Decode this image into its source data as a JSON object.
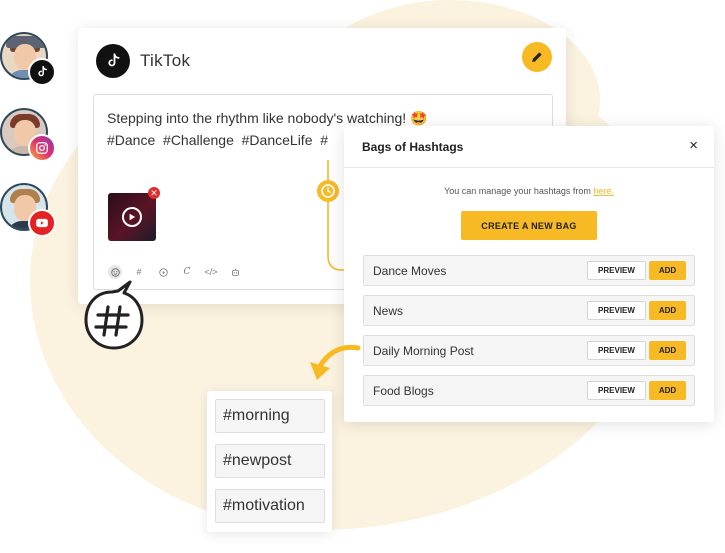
{
  "accounts": [
    {
      "platform": "TikTok",
      "badge_icon": "tiktok-icon"
    },
    {
      "platform": "Instagram",
      "badge_icon": "instagram-icon"
    },
    {
      "platform": "YouTube",
      "badge_icon": "youtube-icon"
    }
  ],
  "post_card": {
    "platform_title": "TikTok",
    "text_line1": "Stepping into the rhythm like nobody's watching! 🤩",
    "text_line2": "#Dance  #Challenge  #DanceLife  #",
    "toolbar_icons": [
      "emoji-icon",
      "hashtag-icon",
      "video-icon",
      "signature-icon",
      "code-icon",
      "ai-icon"
    ]
  },
  "hashtag_panel": {
    "title": "Bags of Hashtags",
    "close_label": "×",
    "manage_text": "You can manage your hashtags from",
    "manage_link": "here.",
    "create_button": "CREATE A NEW BAG",
    "bags": [
      {
        "name": "Dance Moves",
        "preview_label": "PREVIEW",
        "add_label": "ADD"
      },
      {
        "name": "News",
        "preview_label": "PREVIEW",
        "add_label": "ADD"
      },
      {
        "name": "Daily Morning Post",
        "preview_label": "PREVIEW",
        "add_label": "ADD"
      },
      {
        "name": "Food Blogs",
        "preview_label": "PREVIEW",
        "add_label": "ADD"
      }
    ]
  },
  "preview_tags": [
    "#morning",
    "#newpost",
    "#motivation"
  ],
  "colors": {
    "accent": "#f7b924",
    "background_blob": "#fbf3df",
    "remove": "#e12c2c",
    "tiktok": "#111111",
    "youtube": "#e52222"
  }
}
